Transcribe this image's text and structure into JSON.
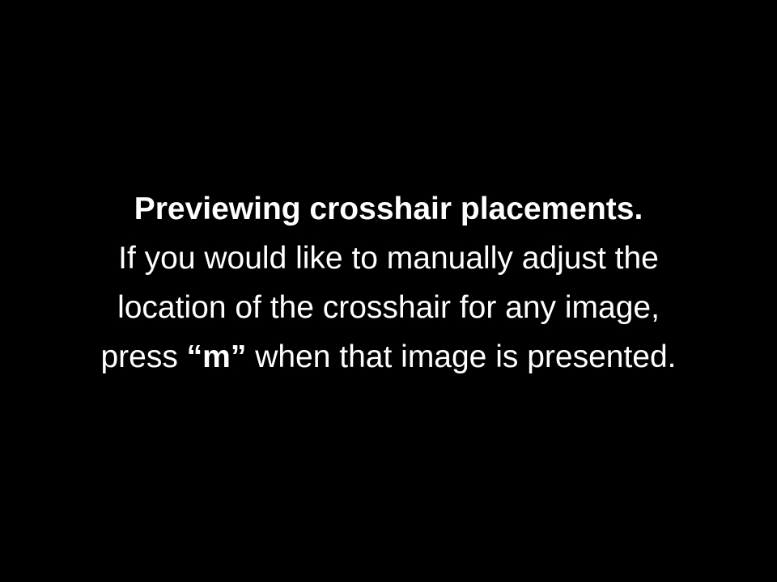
{
  "instructions": {
    "heading": "Previewing crosshair placements.",
    "line_1": "If you would like to manually adjust the",
    "line_2": "location of the crosshair for any image,",
    "line_3_prefix": "press ",
    "line_3_key": "“m”",
    "line_3_suffix": " when that image is presented."
  },
  "colors": {
    "background": "#000000",
    "text": "#ffffff"
  }
}
